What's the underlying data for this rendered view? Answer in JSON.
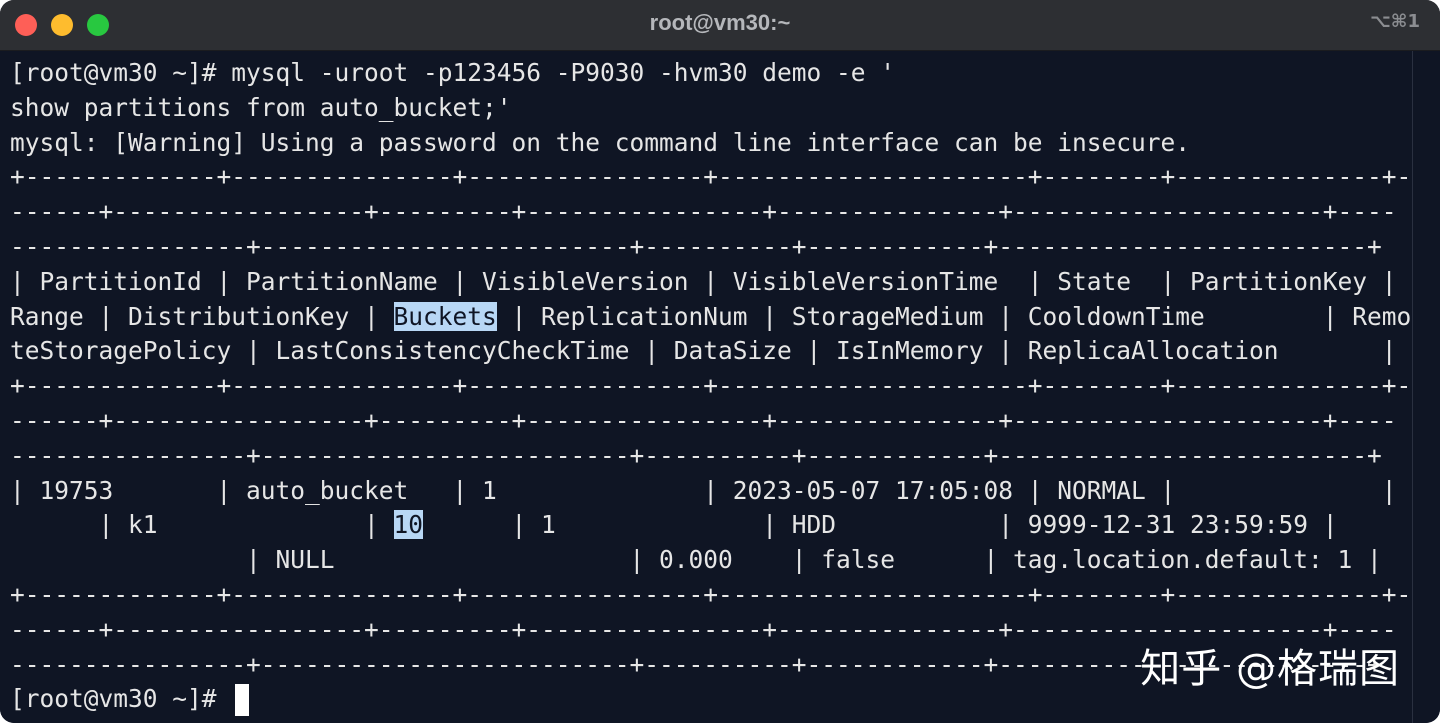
{
  "window": {
    "title": "root@vm30:~",
    "shortcut": "⌥⌘1"
  },
  "terminal": {
    "lines": [
      {
        "text": "[root@vm30 ~]# mysql -uroot -p123456 -P9030 -hvm30 demo -e '"
      },
      {
        "text": "show partitions from auto_bucket;'"
      },
      {
        "text": "mysql: [Warning] Using a password on the command line interface can be insecure."
      },
      {
        "text": "+-------------+---------------+----------------+---------------------+--------+--------------+-"
      },
      {
        "text": "------+-----------------+---------+----------------+---------------+---------------------+----"
      },
      {
        "text": "----------------+-------------------------+----------+------------+-------------------------+"
      },
      {
        "before": "| PartitionId | PartitionName | VisibleVersion | VisibleVersionTime  | State  | PartitionKey |",
        "hl": "",
        "after": ""
      },
      {
        "before": "Range | DistributionKey | ",
        "hl": "Buckets",
        "after": " | ReplicationNum | StorageMedium | CooldownTime        | Remo"
      },
      {
        "before": "teStoragePolicy | LastConsistencyCheckTime | DataSize | IsInMemory | ReplicaAllocation       |",
        "hl": "",
        "after": ""
      },
      {
        "text": "+-------------+---------------+----------------+---------------------+--------+--------------+-"
      },
      {
        "text": "------+-----------------+---------+----------------+---------------+---------------------+----"
      },
      {
        "text": "----------------+-------------------------+----------+------------+-------------------------+"
      },
      {
        "before": "| 19753       | auto_bucket   | 1              | 2023-05-07 17:05:08 | NORMAL |              |",
        "hl": "",
        "after": ""
      },
      {
        "before": "      | k1              | ",
        "hl": "10",
        "after": "      | 1              | HDD           | 9999-12-31 23:59:59 |"
      },
      {
        "before": "                | NULL                    | 0.000    | false      | tag.location.default: 1 |",
        "hl": "",
        "after": ""
      },
      {
        "text": "+-------------+---------------+----------------+---------------------+--------+--------------+-"
      },
      {
        "text": "------+-----------------+---------+----------------+---------------+---------------------+----"
      },
      {
        "text": "----------------+-------------------------+----------+------------+-------------------------+"
      },
      {
        "text": "[root@vm30 ~]# "
      }
    ]
  },
  "watermark": "知乎 @格瑞图"
}
